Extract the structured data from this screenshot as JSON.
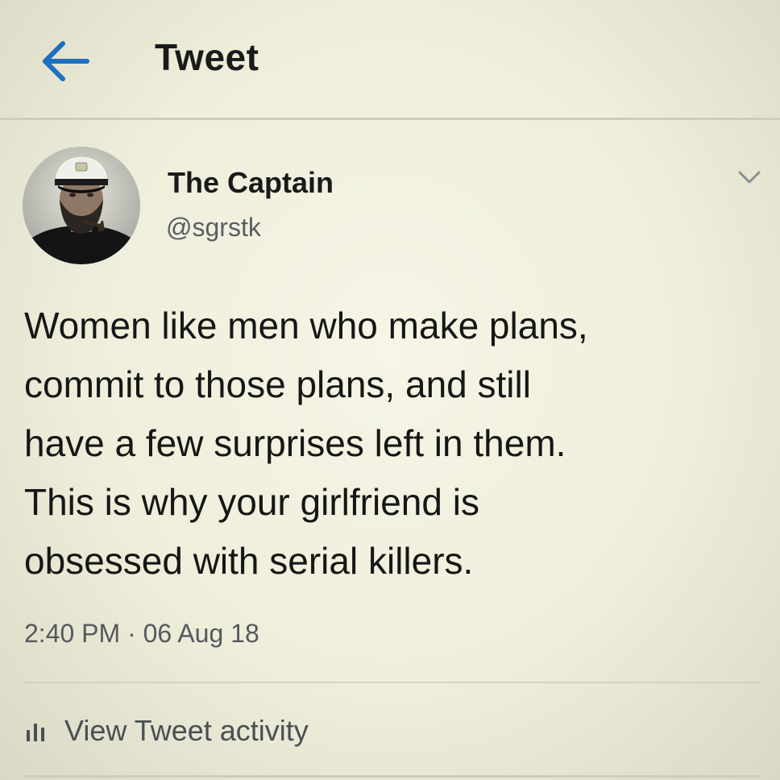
{
  "header": {
    "title": "Tweet",
    "back_icon": "back-arrow-icon",
    "accent_color": "#1d6fbf"
  },
  "tweet": {
    "author": {
      "name": "The Captain",
      "handle": "@sgrstk",
      "avatar": "avatar-man-with-captain-hat"
    },
    "more_icon": "chevron-down-icon",
    "text_lines": [
      "Women like men who make plans,",
      "commit to those plans, and still",
      "have a few surprises left in them.",
      "This is why your girlfriend is",
      "obsessed with serial killers."
    ],
    "timestamp": "2:40 PM · 06 Aug 18",
    "activity": {
      "icon": "bar-chart-icon",
      "label": "View Tweet activity"
    }
  }
}
